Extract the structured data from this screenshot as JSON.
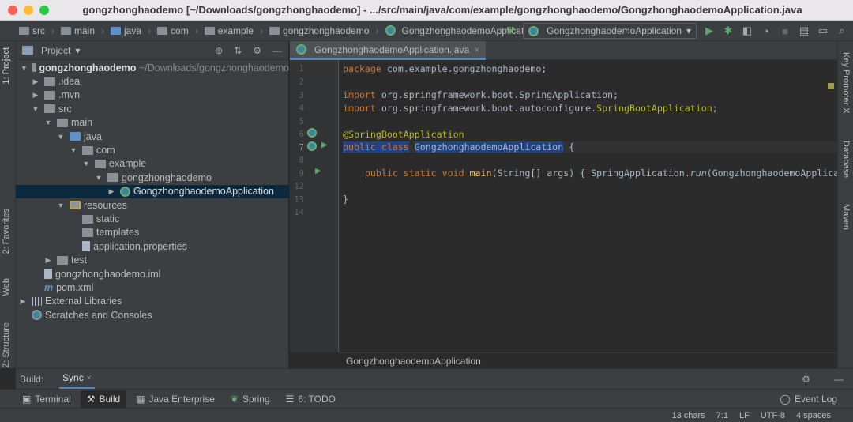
{
  "window": {
    "title": "gongzhonghaodemo [~/Downloads/gongzhonghaodemo] - .../src/main/java/com/example/gongzhonghaodemo/GongzhonghaodemoApplication.java"
  },
  "breadcrumbs": [
    "src",
    "main",
    "java",
    "com",
    "example",
    "gongzhonghaodemo",
    "GongzhonghaodemoApplication"
  ],
  "run_config": "GongzhonghaodemoApplication",
  "left_tabs": {
    "project": "1: Project",
    "favorites": "2: Favorites",
    "web": "Web",
    "structure": "Z: Structure"
  },
  "right_tabs": {
    "key_promoter": "Key Promoter X",
    "database": "Database",
    "maven": "Maven"
  },
  "project_panel": {
    "title": "Project",
    "tree": [
      {
        "label": "gongzhonghaodemo",
        "suffix": "~/Downloads/gongzhonghaodemo",
        "bold": true
      },
      {
        "label": ".idea"
      },
      {
        "label": ".mvn"
      },
      {
        "label": "src"
      },
      {
        "label": "main"
      },
      {
        "label": "java"
      },
      {
        "label": "com"
      },
      {
        "label": "example"
      },
      {
        "label": "gongzhonghaodemo"
      },
      {
        "label": "GongzhonghaodemoApplication"
      },
      {
        "label": "resources"
      },
      {
        "label": "static"
      },
      {
        "label": "templates"
      },
      {
        "label": "application.properties"
      },
      {
        "label": "test"
      },
      {
        "label": "gongzhonghaodemo.iml"
      },
      {
        "label": "pom.xml"
      },
      {
        "label": "External Libraries"
      },
      {
        "label": "Scratches and Consoles"
      }
    ]
  },
  "editor": {
    "tab": "GongzhonghaodemoApplication.java",
    "line_numbers": [
      "1",
      "2",
      "3",
      "4",
      "5",
      "6",
      "7",
      "8",
      "9",
      "12",
      "13",
      "14"
    ],
    "lines": {
      "l1_kw": "package",
      "l1_rest": " com.example.gongzhonghaodemo;",
      "l3_kw": "import",
      "l3_rest": " org.springframework.boot.SpringApplication;",
      "l4_kw": "import",
      "l4_rest": " org.springframework.boot.autoconfigure.",
      "l4_ann": "SpringBootApplication",
      "l4_end": ";",
      "l6": "@SpringBootApplication",
      "l7_kw": "public class",
      "l7_cls": "GongzhonghaodemoApplication",
      "l7_end": " {",
      "l9_kw": "public static void",
      "l9_fn": "main",
      "l9_args": "(String[] args)",
      "l9_body": " { SpringApplication.",
      "l9_run": "run",
      "l9_tail": "(GongzhonghaodemoApplication.cla",
      "l13": "}"
    },
    "footer": "GongzhonghaodemoApplication"
  },
  "build_bar": {
    "label": "Build:",
    "sync": "Sync"
  },
  "bottom_tabs": [
    "Terminal",
    "Build",
    "Java Enterprise",
    "Spring",
    "6: TODO"
  ],
  "event_log": "Event Log",
  "status": {
    "chars": "13 chars",
    "pos": "7:1",
    "lf": "LF",
    "encoding": "UTF-8",
    "indent": "4 spaces"
  },
  "colors": {
    "accent": "#4a88c7",
    "keyword": "#cc7832",
    "annotation": "#bbb529",
    "function": "#ffc66d"
  }
}
